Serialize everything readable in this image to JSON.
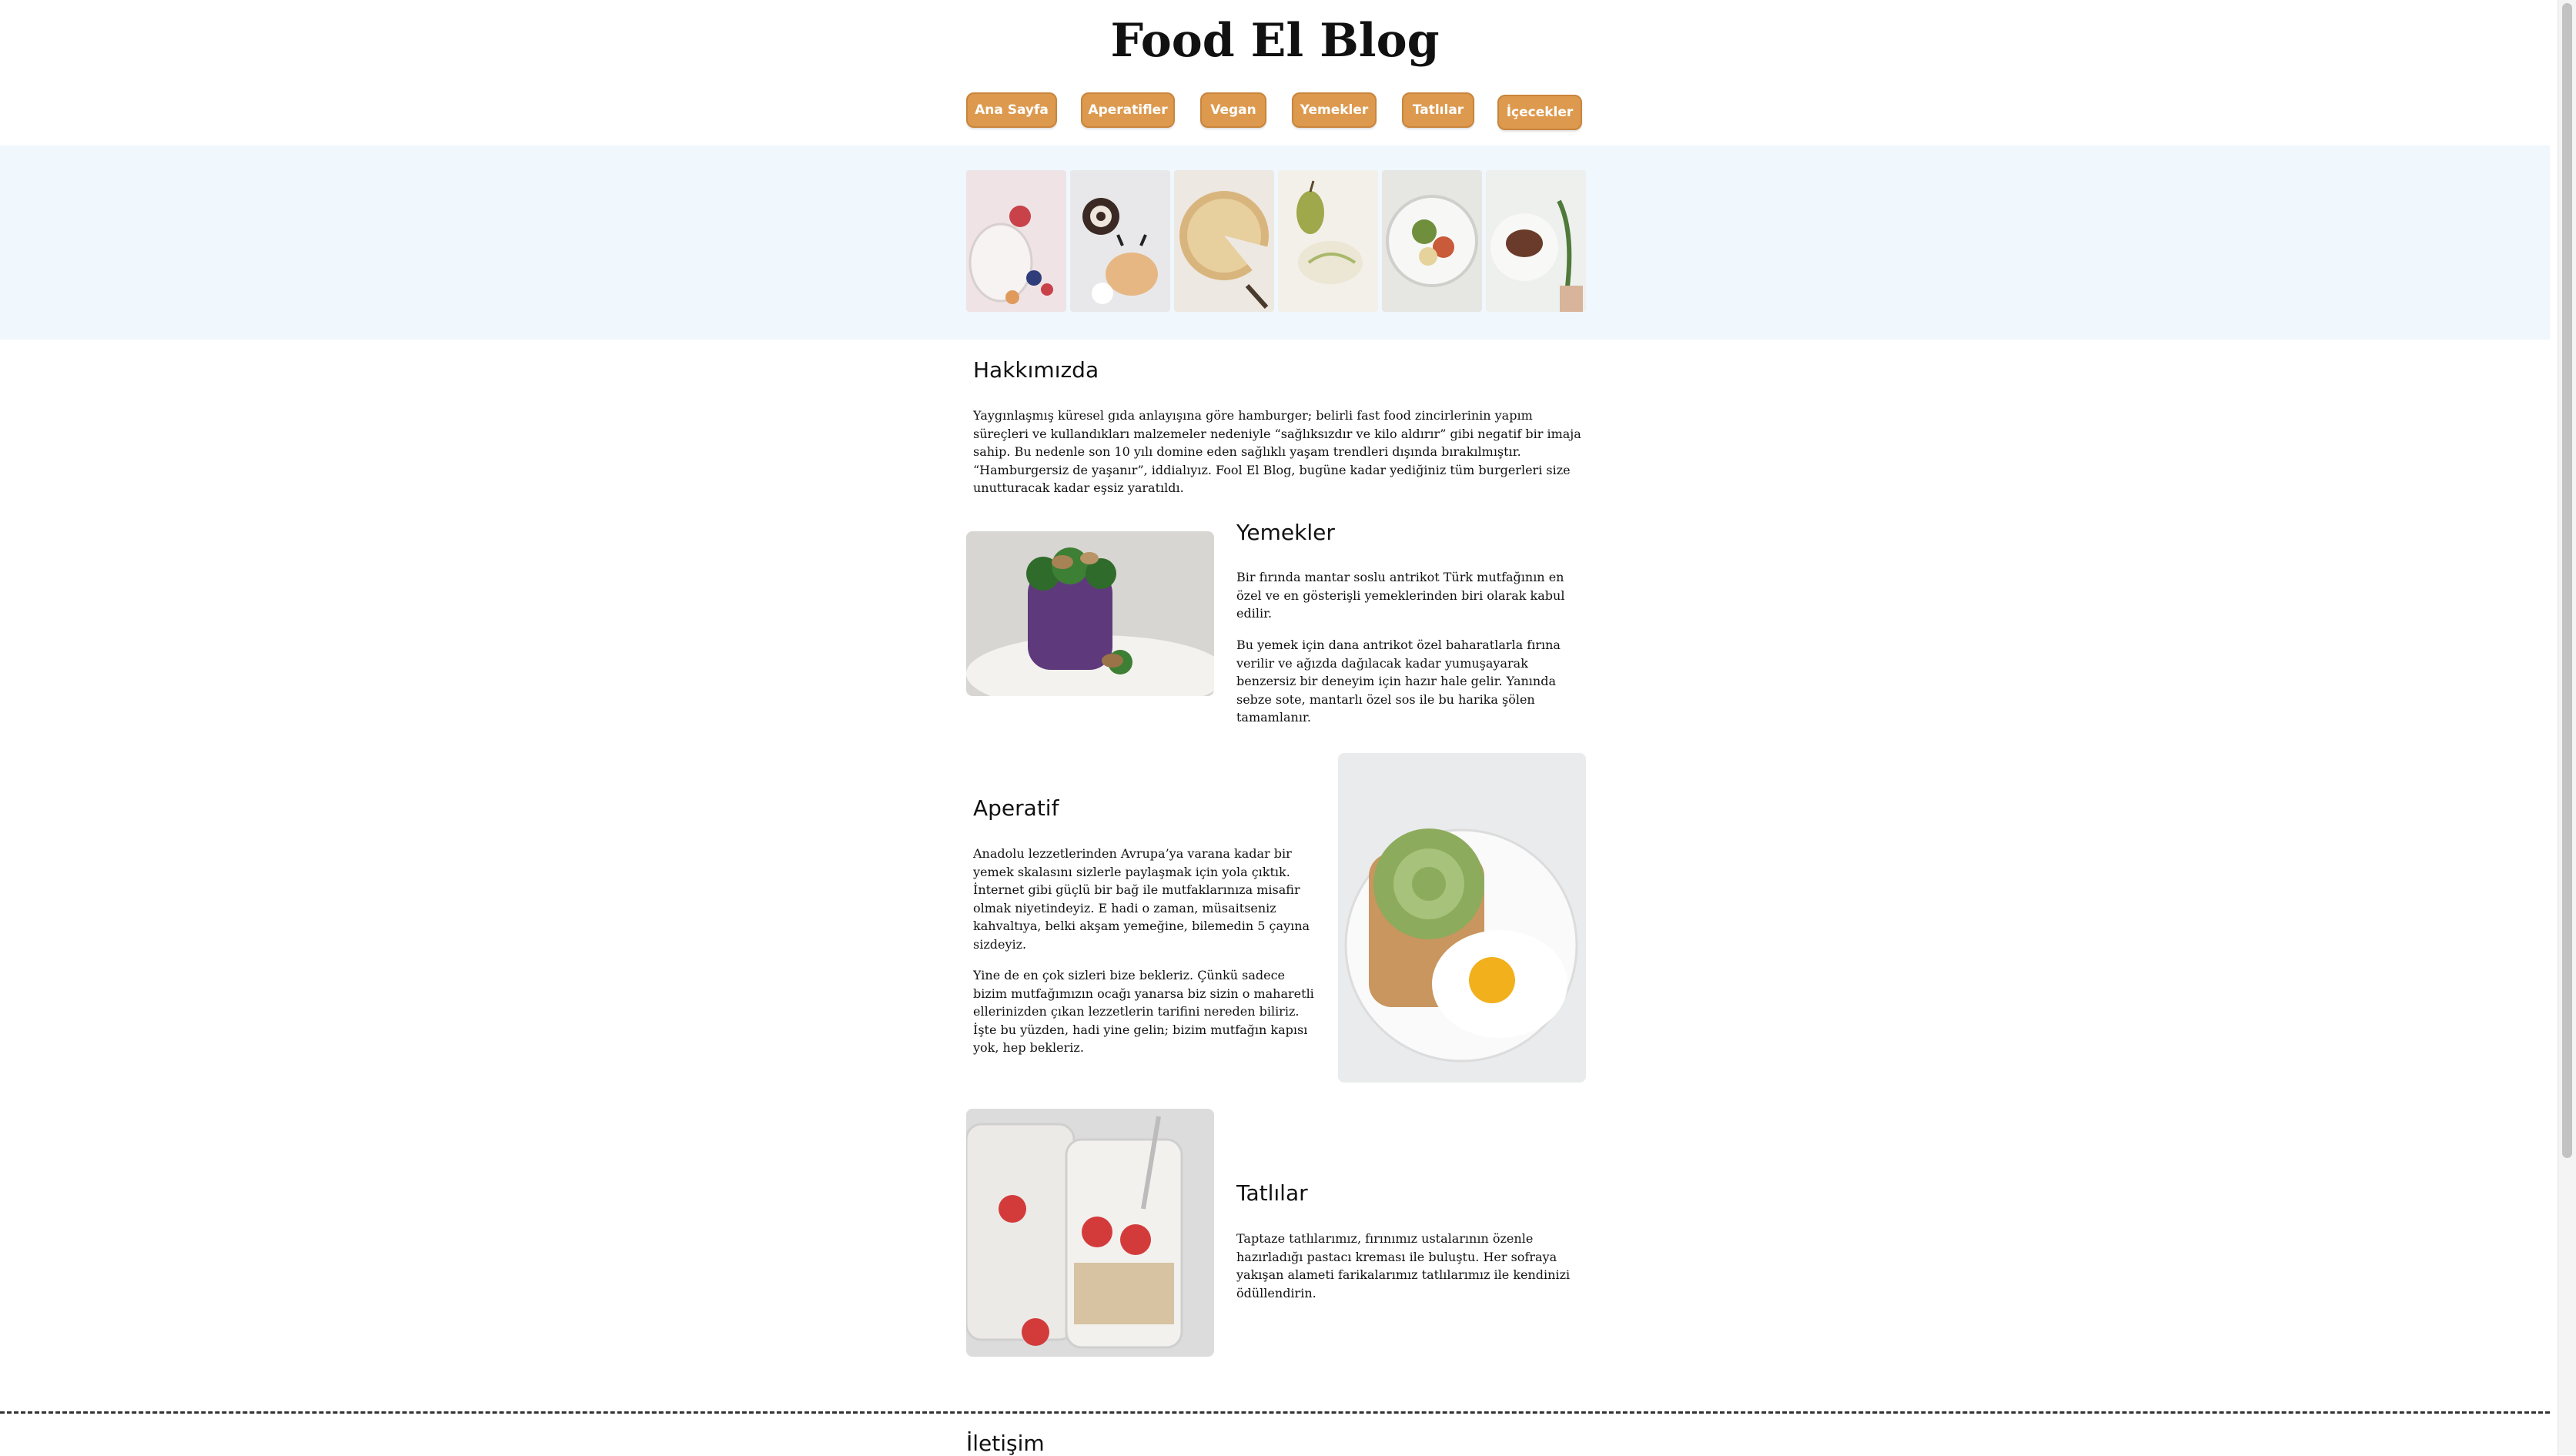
{
  "site": {
    "title": "Food El Blog"
  },
  "nav": {
    "items": [
      {
        "label": "Ana Sayfa"
      },
      {
        "label": "Aperatifler"
      },
      {
        "label": "Vegan"
      },
      {
        "label": "Yemekler"
      },
      {
        "label": "Tatlılar"
      },
      {
        "label": "İçecekler"
      }
    ]
  },
  "about": {
    "title": "Hakkımızda",
    "text": "Yaygınlaşmış küresel gıda anlayışına göre hamburger; belirli fast food zincirlerinin yapım süreçleri ve kullandıkları malzemeler nedeniyle “sağlıksızdır ve kilo aldırır” gibi negatif bir imaja sahip. Bu nedenle son 10 yılı domine eden sağlıklı yaşam trendleri dışında bırakılmıştır. “Hamburgersiz de yaşanır”, iddialıyız. Fool El Blog, bugüne kadar yediğiniz tüm burgerleri size unutturacak kadar eşsiz yaratıldı."
  },
  "yemekler": {
    "title": "Yemekler",
    "p1": "Bir fırında mantar soslu antrikot Türk mutfağının en özel ve en gösterişli yemeklerinden biri olarak kabul edilir.",
    "p2": "Bu yemek için dana antrikot özel baharatlarla fırına verilir ve ağızda dağılacak kadar yumuşayarak benzersiz bir deneyim için hazır hale gelir. Yanında sebze sote, mantarlı özel sos ile bu harika şölen tamamlanır."
  },
  "aperatif": {
    "title": "Aperatif",
    "p1": "Anadolu lezzetlerinden Avrupa’ya varana kadar bir yemek skalasını sizlerle paylaşmak için yola çıktık. İnternet gibi güçlü bir bağ ile mutfaklarınıza misafir olmak niyetindeyiz. E hadi o zaman, müsaitseniz kahvaltıya, belki akşam yemeğine, bilemedin 5 çayına sizdeyiz.",
    "p2": "Yine de en çok sizleri bize bekleriz. Çünkü sadece bizim mutfağımızın ocağı yanarsa biz sizin o maharetli ellerinizden çıkan lezzetlerin tarifini nereden biliriz. İşte bu yüzden, hadi yine gelin; bizim mutfağın kapısı yok, hep bekleriz."
  },
  "tatlilar": {
    "title": "Tatlılar",
    "text": "Taptaze tatlılarımız, fırınımız ustalarının özenle hazırladığı pastacı kreması ile buluştu. Her sofraya yakışan alameti farikalarımız tatlılarımız ile kendinizi ödüllendirin."
  },
  "contact": {
    "title": "İletişim"
  },
  "colors": {
    "nav_button": "#dd9a4f",
    "banner_bg": "#f0f7fd"
  }
}
